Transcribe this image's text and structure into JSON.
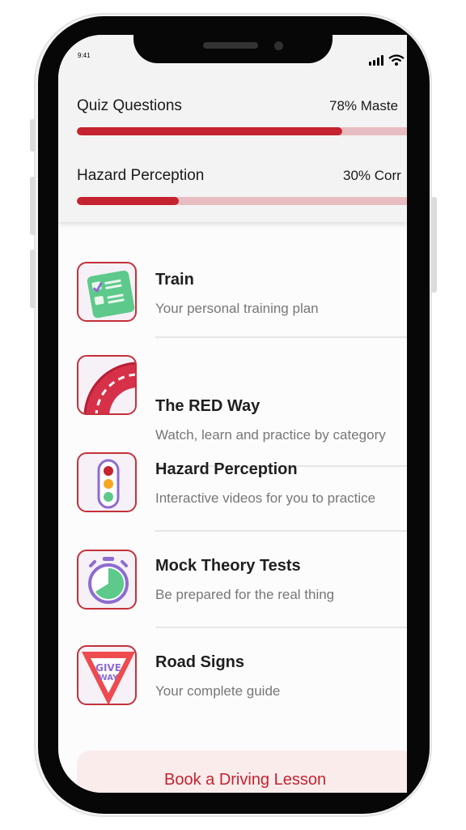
{
  "status": {
    "time": "9:41"
  },
  "progress": [
    {
      "label": "Quiz Questions",
      "value": "78% Maste",
      "fraction": 0.78
    },
    {
      "label": "Hazard Perception",
      "value": "30% Corr",
      "fraction": 0.3
    }
  ],
  "menu": [
    {
      "title": "Train",
      "subtitle": "Your personal training plan",
      "icon": "checklist-icon"
    },
    {
      "title": "The RED Way",
      "subtitle": "Watch, learn and practice by category",
      "icon": "road-icon"
    },
    {
      "title": "Hazard Perception",
      "subtitle": "Interactive videos for you to practice",
      "icon": "traffic-light-icon"
    },
    {
      "title": "Mock Theory Tests",
      "subtitle": "Be prepared for the real thing",
      "icon": "stopwatch-icon"
    },
    {
      "title": "Road Signs",
      "subtitle": "Your complete guide",
      "icon": "give-way-sign-icon",
      "sign_text": [
        "GIVE",
        "WAY"
      ]
    }
  ],
  "book_button": {
    "label": "Book a Driving Lesson"
  },
  "colors": {
    "accent": "#c4232f",
    "track": "#e8bdc1",
    "icon_green": "#5dc98a",
    "icon_purple": "#8e6cd0",
    "icon_amber": "#f5a623"
  }
}
